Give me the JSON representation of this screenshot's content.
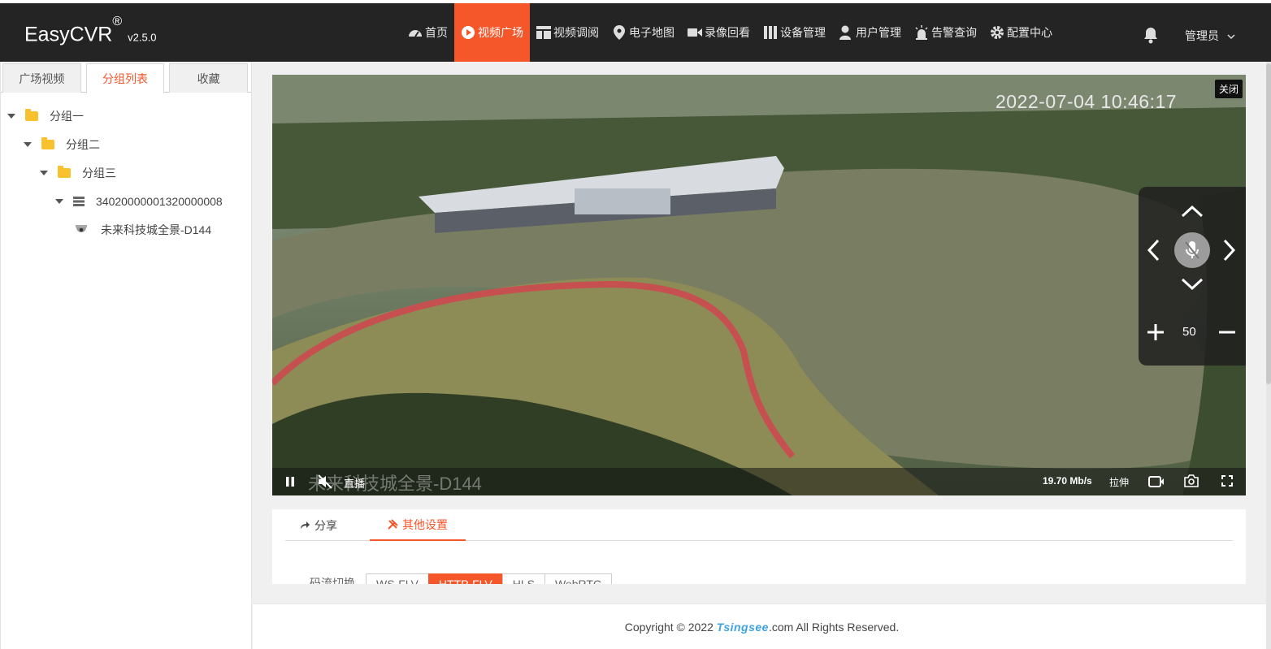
{
  "header": {
    "logo": "EasyCVR",
    "logo_mark": "®",
    "version": "v2.5.0",
    "nav": [
      {
        "label": "首页",
        "icon": "dashboard-icon"
      },
      {
        "label": "视频广场",
        "icon": "play-circle-icon",
        "active": true
      },
      {
        "label": "视频调阅",
        "icon": "grid-layout-icon"
      },
      {
        "label": "电子地图",
        "icon": "map-pin-icon"
      },
      {
        "label": "录像回看",
        "icon": "video-camera-icon"
      },
      {
        "label": "设备管理",
        "icon": "server-icon"
      },
      {
        "label": "用户管理",
        "icon": "user-icon"
      },
      {
        "label": "告警查询",
        "icon": "alarm-icon"
      },
      {
        "label": "配置中心",
        "icon": "gear-icon"
      }
    ],
    "user": "管理员"
  },
  "sidebar": {
    "tabs": [
      "广场视频",
      "分组列表",
      "收藏"
    ],
    "active_tab": "分组列表",
    "tree": [
      {
        "label": "分组一",
        "type": "folder"
      },
      {
        "label": "分组二",
        "type": "folder"
      },
      {
        "label": "分组三",
        "type": "folder"
      },
      {
        "label": "34020000001320000008",
        "type": "device"
      },
      {
        "label": "未来科技城全景-D144",
        "type": "camera"
      }
    ]
  },
  "player": {
    "timestamp": "2022-07-04 10:46:17",
    "close_label": "关闭",
    "watermark": "未来科技城全景-D144",
    "live_label": "直播",
    "bitrate": "19.70 Mb/s",
    "stretch_label": "拉伸",
    "zoom_value": "50"
  },
  "panel": {
    "tabs": [
      "分享",
      "其他设置"
    ],
    "active_tab": "其他设置",
    "stream_label": "码流切换",
    "stream_options": [
      "WS-FLV",
      "HTTP-FLV",
      "HLS",
      "WebRTC"
    ],
    "active_stream": "HTTP-FLV"
  },
  "footer": {
    "prefix": "Copyright © 2022 ",
    "brand": "Tsingsee",
    "suffix": ".com All Rights Reserved."
  },
  "colors": {
    "accent": "#f5562a",
    "topbar": "#242424"
  }
}
